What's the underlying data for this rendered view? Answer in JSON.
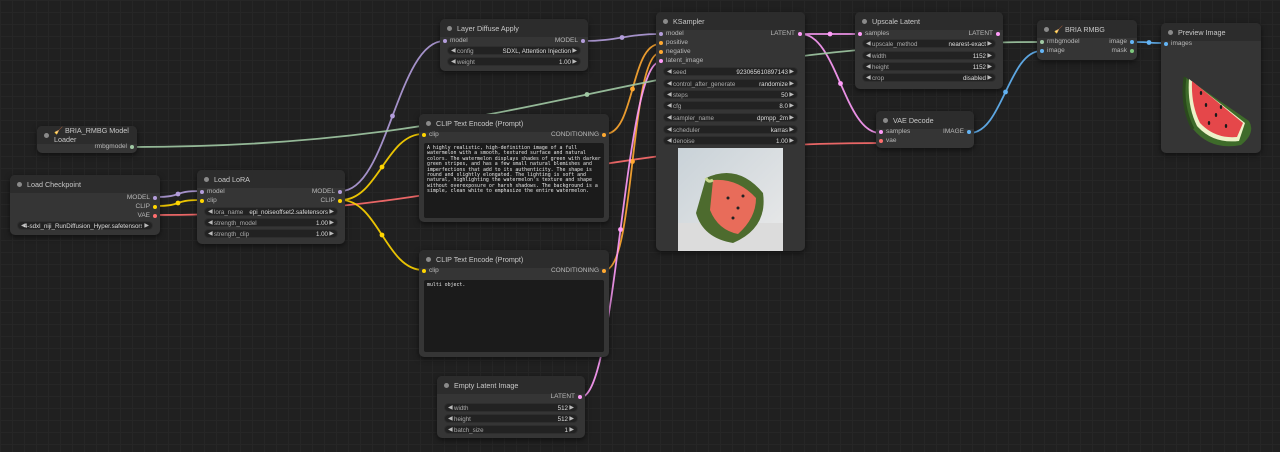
{
  "colors": {
    "model": "#b39ddb",
    "clip": "#ffd500",
    "vae": "#ff6e6e",
    "conditioning": "#ffa931",
    "latent": "#ff9cf9",
    "image": "#64b5f6",
    "rmbg": "#a1c9a4"
  },
  "nodes": {
    "load_checkpoint": {
      "title": "Load Checkpoint",
      "outputs": [
        "MODEL",
        "CLIP",
        "VAE"
      ],
      "ckpt_value": "4-sdxl_niji_RunDiffusion_Hyper.safetensors"
    },
    "bria_loader": {
      "title": "🧹 BRIA_RMBG Model Loader",
      "output": "rmbgmodel"
    },
    "load_lora": {
      "title": "Load LoRA",
      "inputs": [
        "model",
        "clip"
      ],
      "outputs": [
        "MODEL",
        "CLIP"
      ],
      "widgets": [
        {
          "label": "lora_name",
          "value": "epi_noiseoffset2.safetensors"
        },
        {
          "label": "strength_model",
          "value": "1.00"
        },
        {
          "label": "strength_clip",
          "value": "1.00"
        }
      ]
    },
    "layer_diffuse": {
      "title": "Layer Diffuse Apply",
      "input": "model",
      "output": "MODEL",
      "widgets": [
        {
          "label": "config",
          "value": "SDXL, Attention Injection"
        },
        {
          "label": "weight",
          "value": "1.00"
        }
      ]
    },
    "clip_pos": {
      "title": "CLIP Text Encode (Prompt)",
      "input": "clip",
      "output": "CONDITIONING",
      "text": "A highly realistic, high-definition image of a full watermelon with a smooth, textured surface and natural colors. The watermelon displays shades of green with darker green stripes, and has a few small natural blemishes and imperfections that add to its authenticity. The shape is round and slightly elongated. The lighting is soft and natural, highlighting the watermelon's texture and shape without overexposure or harsh shadows. The background is a simple, clean white to emphasize the entire watermelon."
    },
    "clip_neg": {
      "title": "CLIP Text Encode (Prompt)",
      "input": "clip",
      "output": "CONDITIONING",
      "text": "multi object."
    },
    "empty_latent": {
      "title": "Empty Latent Image",
      "output": "LATENT",
      "widgets": [
        {
          "label": "width",
          "value": "512"
        },
        {
          "label": "height",
          "value": "512"
        },
        {
          "label": "batch_size",
          "value": "1"
        }
      ]
    },
    "ksampler": {
      "title": "KSampler",
      "inputs": [
        "model",
        "positive",
        "negative",
        "latent_image"
      ],
      "output": "LATENT",
      "widgets": [
        {
          "label": "seed",
          "value": "923065610897143"
        },
        {
          "label": "control_after_generate",
          "value": "randomize"
        },
        {
          "label": "steps",
          "value": "50"
        },
        {
          "label": "cfg",
          "value": "8.0"
        },
        {
          "label": "sampler_name",
          "value": "dpmpp_2m"
        },
        {
          "label": "scheduler",
          "value": "karras"
        },
        {
          "label": "denoise",
          "value": "1.00"
        }
      ]
    },
    "upscale": {
      "title": "Upscale Latent",
      "input": "samples",
      "output": "LATENT",
      "widgets": [
        {
          "label": "upscale_method",
          "value": "nearest-exact"
        },
        {
          "label": "width",
          "value": "1152"
        },
        {
          "label": "height",
          "value": "1152"
        },
        {
          "label": "crop",
          "value": "disabled"
        }
      ]
    },
    "vae_decode": {
      "title": "VAE Decode",
      "inputs": [
        "samples",
        "vae"
      ],
      "output": "IMAGE"
    },
    "bria_rmbg": {
      "title": "🧹 BRIA RMBG",
      "inputs": [
        "rmbgmodel",
        "image"
      ],
      "outputs": [
        "image",
        "mask"
      ]
    },
    "preview": {
      "title": "Preview Image",
      "input": "images"
    }
  }
}
